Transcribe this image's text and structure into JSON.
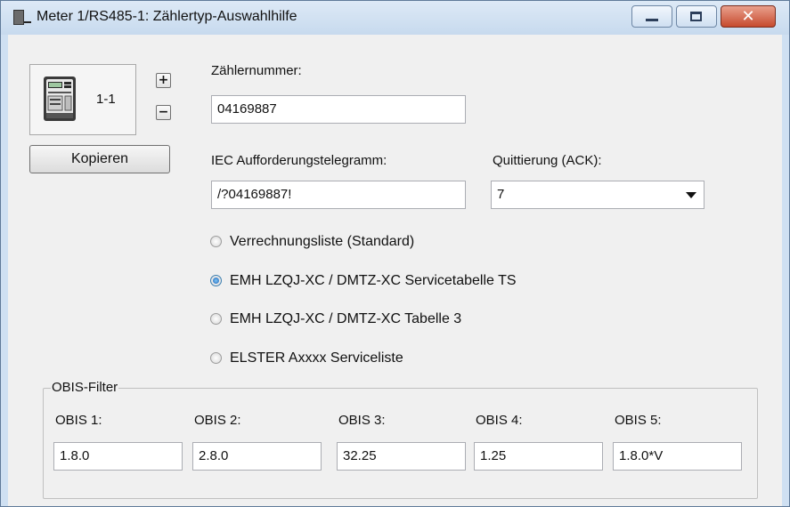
{
  "window": {
    "title": "Meter 1/RS485-1: Zählertyp-Auswahlhilfe",
    "close_glyph": "✕",
    "accent_close": "#c64a2e"
  },
  "meter": {
    "icon": "meter-device-icon",
    "label": "1-1",
    "plus": "+",
    "minus": "−",
    "copy_label": "Kopieren"
  },
  "fields": {
    "meter_number_label": "Zählernummer:",
    "meter_number": "04169887",
    "iec_label": "IEC Aufforderungstelegramm:",
    "iec_value": "/?04169887!",
    "ack_label": "Quittierung (ACK):",
    "ack_value": "7"
  },
  "radios": [
    {
      "label": "Verrechnungsliste (Standard)",
      "selected": false
    },
    {
      "label": "EMH LZQJ-XC / DMTZ-XC Servicetabelle TS",
      "selected": true
    },
    {
      "label": "EMH LZQJ-XC / DMTZ-XC Tabelle 3",
      "selected": false
    },
    {
      "label": "ELSTER Axxxx Serviceliste",
      "selected": false
    }
  ],
  "obis": {
    "group_title": "OBIS-Filter",
    "labels": [
      "OBIS 1:",
      "OBIS 2:",
      "OBIS 3:",
      "OBIS 4:",
      "OBIS 5:"
    ],
    "values": [
      "1.8.0",
      "2.8.0",
      "32.25",
      "1.25",
      "1.8.0*V"
    ]
  }
}
